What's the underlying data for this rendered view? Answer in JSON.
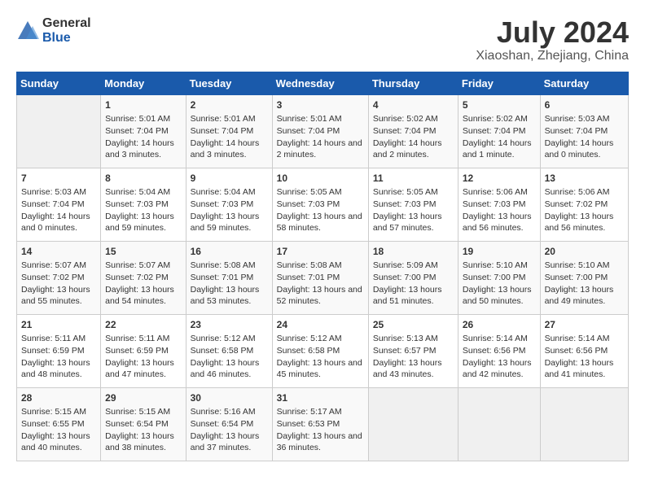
{
  "logo": {
    "general": "General",
    "blue": "Blue"
  },
  "title": "July 2024",
  "subtitle": "Xiaoshan, Zhejiang, China",
  "days_of_week": [
    "Sunday",
    "Monday",
    "Tuesday",
    "Wednesday",
    "Thursday",
    "Friday",
    "Saturday"
  ],
  "weeks": [
    [
      {
        "day": "",
        "sunrise": "",
        "sunset": "",
        "daylight": ""
      },
      {
        "day": "1",
        "sunrise": "Sunrise: 5:01 AM",
        "sunset": "Sunset: 7:04 PM",
        "daylight": "Daylight: 14 hours and 3 minutes."
      },
      {
        "day": "2",
        "sunrise": "Sunrise: 5:01 AM",
        "sunset": "Sunset: 7:04 PM",
        "daylight": "Daylight: 14 hours and 3 minutes."
      },
      {
        "day": "3",
        "sunrise": "Sunrise: 5:01 AM",
        "sunset": "Sunset: 7:04 PM",
        "daylight": "Daylight: 14 hours and 2 minutes."
      },
      {
        "day": "4",
        "sunrise": "Sunrise: 5:02 AM",
        "sunset": "Sunset: 7:04 PM",
        "daylight": "Daylight: 14 hours and 2 minutes."
      },
      {
        "day": "5",
        "sunrise": "Sunrise: 5:02 AM",
        "sunset": "Sunset: 7:04 PM",
        "daylight": "Daylight: 14 hours and 1 minute."
      },
      {
        "day": "6",
        "sunrise": "Sunrise: 5:03 AM",
        "sunset": "Sunset: 7:04 PM",
        "daylight": "Daylight: 14 hours and 0 minutes."
      }
    ],
    [
      {
        "day": "7",
        "sunrise": "Sunrise: 5:03 AM",
        "sunset": "Sunset: 7:04 PM",
        "daylight": "Daylight: 14 hours and 0 minutes."
      },
      {
        "day": "8",
        "sunrise": "Sunrise: 5:04 AM",
        "sunset": "Sunset: 7:03 PM",
        "daylight": "Daylight: 13 hours and 59 minutes."
      },
      {
        "day": "9",
        "sunrise": "Sunrise: 5:04 AM",
        "sunset": "Sunset: 7:03 PM",
        "daylight": "Daylight: 13 hours and 59 minutes."
      },
      {
        "day": "10",
        "sunrise": "Sunrise: 5:05 AM",
        "sunset": "Sunset: 7:03 PM",
        "daylight": "Daylight: 13 hours and 58 minutes."
      },
      {
        "day": "11",
        "sunrise": "Sunrise: 5:05 AM",
        "sunset": "Sunset: 7:03 PM",
        "daylight": "Daylight: 13 hours and 57 minutes."
      },
      {
        "day": "12",
        "sunrise": "Sunrise: 5:06 AM",
        "sunset": "Sunset: 7:03 PM",
        "daylight": "Daylight: 13 hours and 56 minutes."
      },
      {
        "day": "13",
        "sunrise": "Sunrise: 5:06 AM",
        "sunset": "Sunset: 7:02 PM",
        "daylight": "Daylight: 13 hours and 56 minutes."
      }
    ],
    [
      {
        "day": "14",
        "sunrise": "Sunrise: 5:07 AM",
        "sunset": "Sunset: 7:02 PM",
        "daylight": "Daylight: 13 hours and 55 minutes."
      },
      {
        "day": "15",
        "sunrise": "Sunrise: 5:07 AM",
        "sunset": "Sunset: 7:02 PM",
        "daylight": "Daylight: 13 hours and 54 minutes."
      },
      {
        "day": "16",
        "sunrise": "Sunrise: 5:08 AM",
        "sunset": "Sunset: 7:01 PM",
        "daylight": "Daylight: 13 hours and 53 minutes."
      },
      {
        "day": "17",
        "sunrise": "Sunrise: 5:08 AM",
        "sunset": "Sunset: 7:01 PM",
        "daylight": "Daylight: 13 hours and 52 minutes."
      },
      {
        "day": "18",
        "sunrise": "Sunrise: 5:09 AM",
        "sunset": "Sunset: 7:00 PM",
        "daylight": "Daylight: 13 hours and 51 minutes."
      },
      {
        "day": "19",
        "sunrise": "Sunrise: 5:10 AM",
        "sunset": "Sunset: 7:00 PM",
        "daylight": "Daylight: 13 hours and 50 minutes."
      },
      {
        "day": "20",
        "sunrise": "Sunrise: 5:10 AM",
        "sunset": "Sunset: 7:00 PM",
        "daylight": "Daylight: 13 hours and 49 minutes."
      }
    ],
    [
      {
        "day": "21",
        "sunrise": "Sunrise: 5:11 AM",
        "sunset": "Sunset: 6:59 PM",
        "daylight": "Daylight: 13 hours and 48 minutes."
      },
      {
        "day": "22",
        "sunrise": "Sunrise: 5:11 AM",
        "sunset": "Sunset: 6:59 PM",
        "daylight": "Daylight: 13 hours and 47 minutes."
      },
      {
        "day": "23",
        "sunrise": "Sunrise: 5:12 AM",
        "sunset": "Sunset: 6:58 PM",
        "daylight": "Daylight: 13 hours and 46 minutes."
      },
      {
        "day": "24",
        "sunrise": "Sunrise: 5:12 AM",
        "sunset": "Sunset: 6:58 PM",
        "daylight": "Daylight: 13 hours and 45 minutes."
      },
      {
        "day": "25",
        "sunrise": "Sunrise: 5:13 AM",
        "sunset": "Sunset: 6:57 PM",
        "daylight": "Daylight: 13 hours and 43 minutes."
      },
      {
        "day": "26",
        "sunrise": "Sunrise: 5:14 AM",
        "sunset": "Sunset: 6:56 PM",
        "daylight": "Daylight: 13 hours and 42 minutes."
      },
      {
        "day": "27",
        "sunrise": "Sunrise: 5:14 AM",
        "sunset": "Sunset: 6:56 PM",
        "daylight": "Daylight: 13 hours and 41 minutes."
      }
    ],
    [
      {
        "day": "28",
        "sunrise": "Sunrise: 5:15 AM",
        "sunset": "Sunset: 6:55 PM",
        "daylight": "Daylight: 13 hours and 40 minutes."
      },
      {
        "day": "29",
        "sunrise": "Sunrise: 5:15 AM",
        "sunset": "Sunset: 6:54 PM",
        "daylight": "Daylight: 13 hours and 38 minutes."
      },
      {
        "day": "30",
        "sunrise": "Sunrise: 5:16 AM",
        "sunset": "Sunset: 6:54 PM",
        "daylight": "Daylight: 13 hours and 37 minutes."
      },
      {
        "day": "31",
        "sunrise": "Sunrise: 5:17 AM",
        "sunset": "Sunset: 6:53 PM",
        "daylight": "Daylight: 13 hours and 36 minutes."
      },
      {
        "day": "",
        "sunrise": "",
        "sunset": "",
        "daylight": ""
      },
      {
        "day": "",
        "sunrise": "",
        "sunset": "",
        "daylight": ""
      },
      {
        "day": "",
        "sunrise": "",
        "sunset": "",
        "daylight": ""
      }
    ]
  ]
}
